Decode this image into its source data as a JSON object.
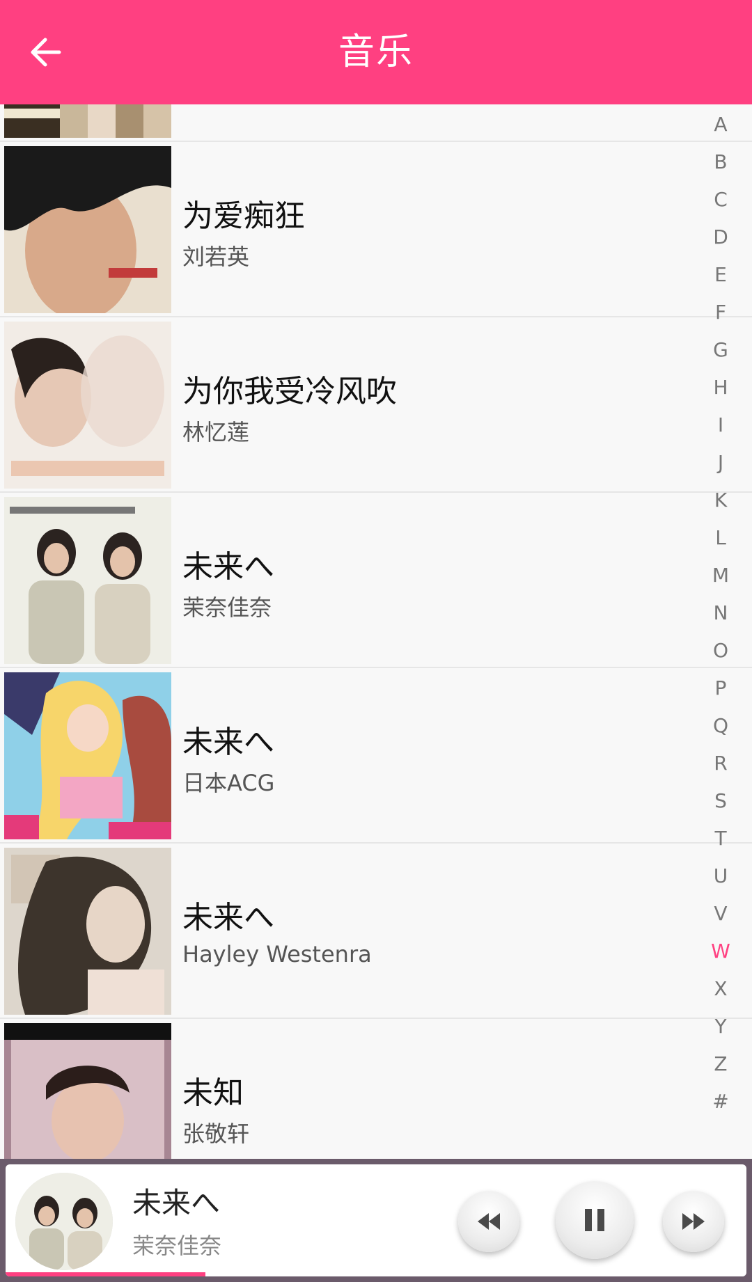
{
  "header": {
    "title": "音乐",
    "back_icon": "arrow-left-icon"
  },
  "songs": [
    {
      "title": "",
      "artist": ""
    },
    {
      "title": "为爱痴狂",
      "artist": "刘若英"
    },
    {
      "title": "为你我受冷风吹",
      "artist": "林忆莲"
    },
    {
      "title": "未来へ",
      "artist": "茉奈佳奈"
    },
    {
      "title": "未来へ",
      "artist": "日本ACG"
    },
    {
      "title": "未来へ",
      "artist": "Hayley Westenra"
    },
    {
      "title": "未知",
      "artist": "张敬轩"
    }
  ],
  "index_bar": {
    "letters": [
      "A",
      "B",
      "C",
      "D",
      "E",
      "F",
      "G",
      "H",
      "I",
      "J",
      "K",
      "L",
      "M",
      "N",
      "O",
      "P",
      "Q",
      "R",
      "S",
      "T",
      "U",
      "V",
      "W",
      "X",
      "Y",
      "Z",
      "#"
    ],
    "active": "W"
  },
  "now_playing": {
    "title": "未来へ",
    "artist": "茉奈佳奈",
    "progress": 0.27
  },
  "colors": {
    "accent": "#ff4081",
    "header_text": "#ffffff",
    "player_frame": "#6b5b6b"
  },
  "controls": {
    "prev_icon": "rewind-icon",
    "pause_icon": "pause-icon",
    "next_icon": "fast-forward-icon"
  }
}
